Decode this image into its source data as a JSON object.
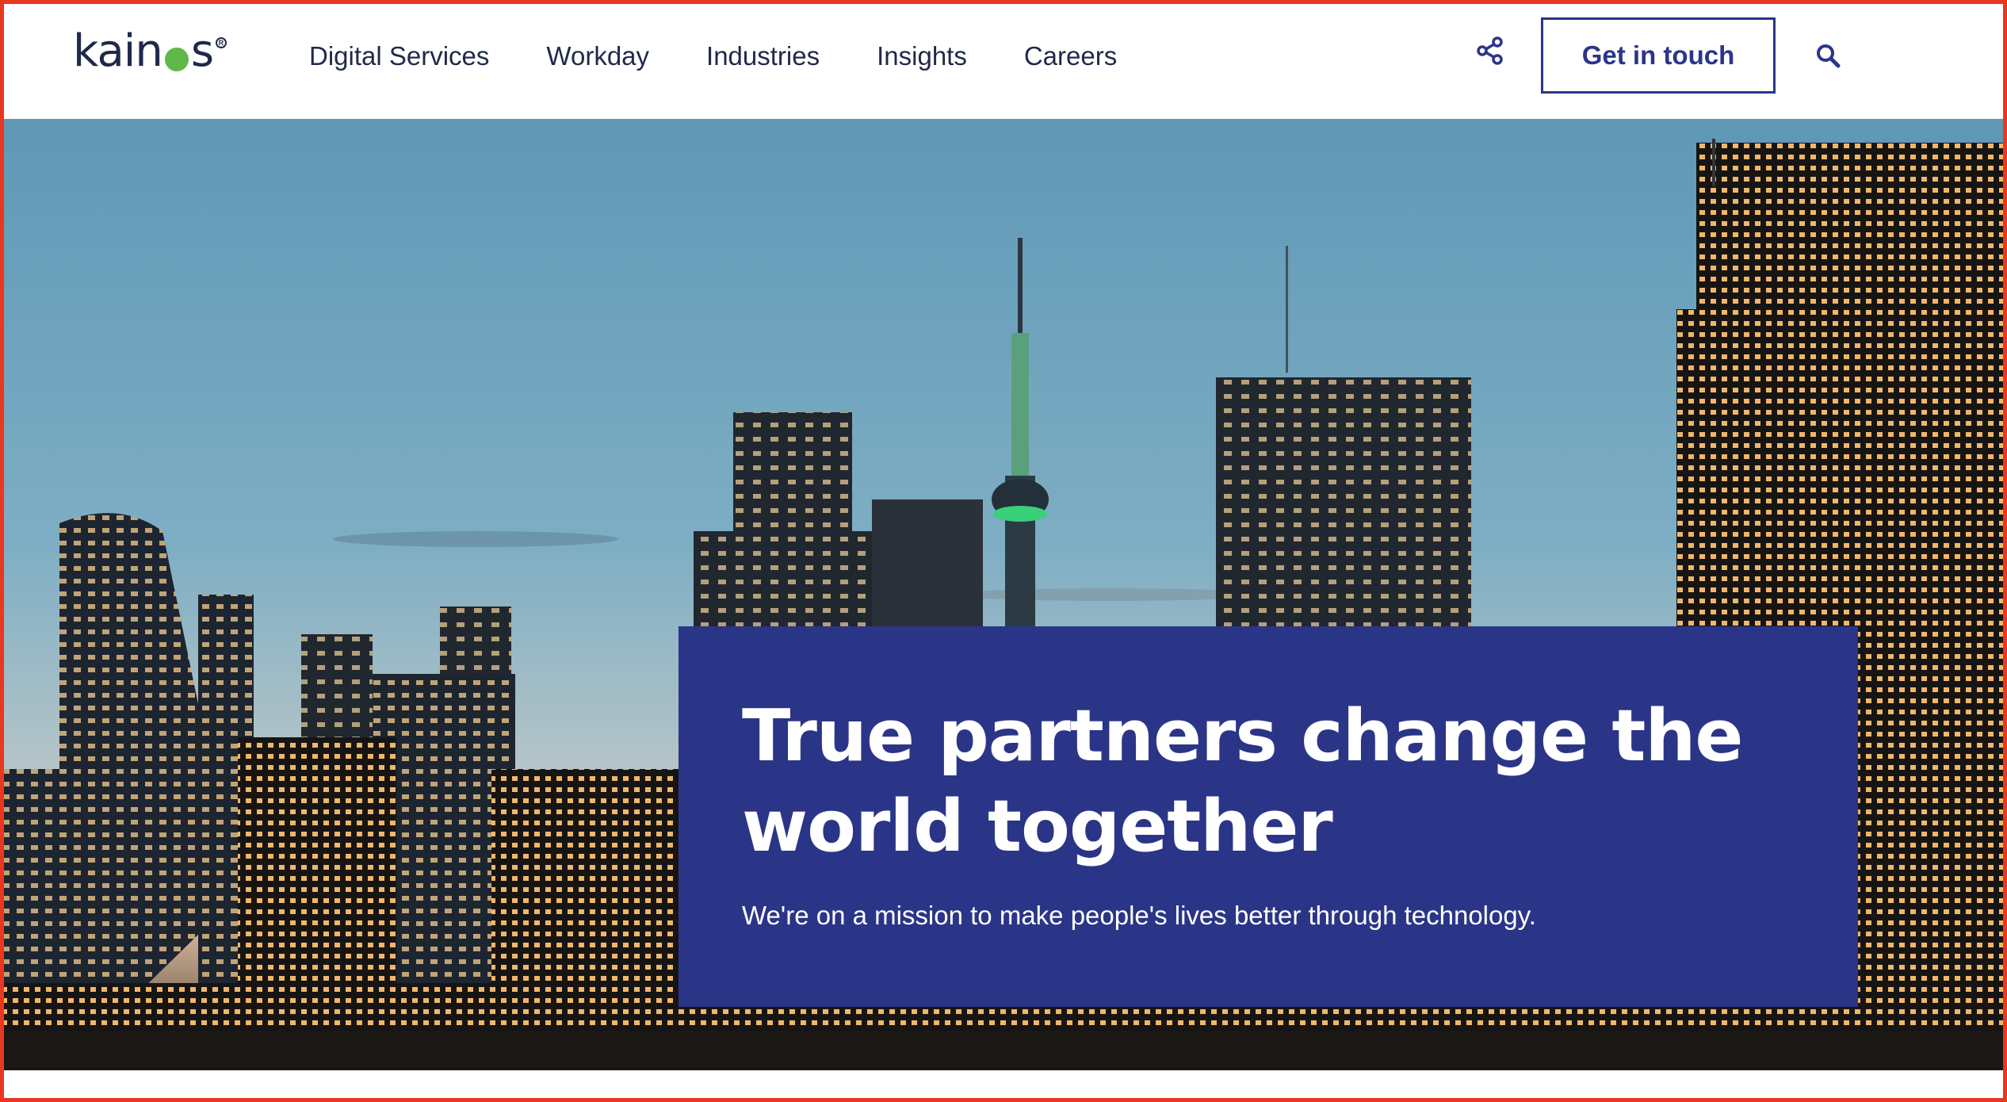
{
  "brand": {
    "logo_text_before": "kain",
    "logo_text_after": "s",
    "logo_dot_color": "#5fb84a",
    "text_color": "#1f2a4a"
  },
  "nav": {
    "items": [
      {
        "label": "Digital Services"
      },
      {
        "label": "Workday"
      },
      {
        "label": "Industries"
      },
      {
        "label": "Insights"
      },
      {
        "label": "Careers"
      }
    ]
  },
  "header_actions": {
    "share_icon": "share-icon",
    "cta_label": "Get in touch",
    "search_icon": "search-icon"
  },
  "hero": {
    "background": "city-skyline-at-dusk",
    "title": "True partners change the world together",
    "subtitle": "We're on a mission to make people's lives better through technology.",
    "card_color": "#2b3587"
  },
  "colors": {
    "accent": "#2a358c",
    "frame": "#e8381f"
  }
}
